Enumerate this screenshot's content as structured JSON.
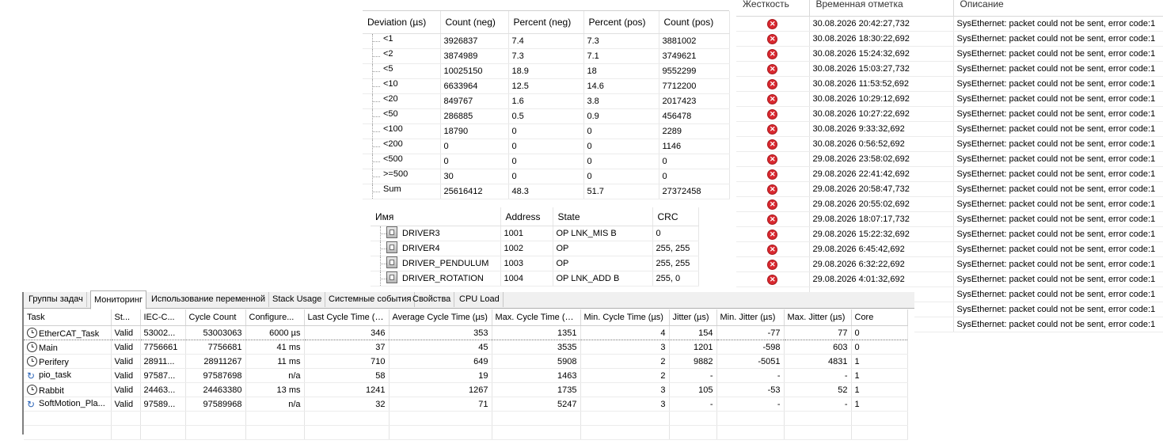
{
  "deviation_table": {
    "headers": [
      "Deviation (µs)",
      "Count (neg)",
      "Percent (neg)",
      "Percent (pos)",
      "Count (pos)"
    ],
    "rows": [
      [
        "<1",
        "3926837",
        "7.4",
        "7.3",
        "3881002"
      ],
      [
        "<2",
        "3874989",
        "7.3",
        "7.1",
        "3749621"
      ],
      [
        "<5",
        "10025150",
        "18.9",
        "18",
        "9552299"
      ],
      [
        "<10",
        "6633964",
        "12.5",
        "14.6",
        "7712200"
      ],
      [
        "<20",
        "849767",
        "1.6",
        "3.8",
        "2017423"
      ],
      [
        "<50",
        "286885",
        "0.5",
        "0.9",
        "456478"
      ],
      [
        "<100",
        "18790",
        "0",
        "0",
        "2289"
      ],
      [
        "<200",
        "0",
        "0",
        "0",
        "1146"
      ],
      [
        "<500",
        "0",
        "0",
        "0",
        "0"
      ],
      [
        ">=500",
        "30",
        "0",
        "0",
        "0"
      ],
      [
        "Sum",
        "25616412",
        "48.3",
        "51.7",
        "27372458"
      ]
    ]
  },
  "drivers_table": {
    "headers": [
      "Имя",
      "Address",
      "State",
      "CRC"
    ],
    "rows": [
      [
        "DRIVER3",
        "1001",
        "OP LNK_MIS B",
        "0"
      ],
      [
        "DRIVER4",
        "1002",
        "OP",
        "255, 255"
      ],
      [
        "DRIVER_PENDULUM",
        "1003",
        "OP",
        "255, 255"
      ],
      [
        "DRIVER_ROTATION",
        "1004",
        "OP LNK_ADD B",
        "255, 0"
      ]
    ]
  },
  "event_log": {
    "headers": [
      "Жесткость",
      "Временная отметка",
      "Описание"
    ],
    "severity_icon": "error-icon",
    "error_color": "#d9282f",
    "rows": [
      [
        "30.08.2026 20:42:27,732",
        "SysEthernet: packet could not be sent, error code:1"
      ],
      [
        "30.08.2026 18:30:22,692",
        "SysEthernet: packet could not be sent, error code:1"
      ],
      [
        "30.08.2026 15:24:32,692",
        "SysEthernet: packet could not be sent, error code:1"
      ],
      [
        "30.08.2026 15:03:27,732",
        "SysEthernet: packet could not be sent, error code:1"
      ],
      [
        "30.08.2026 11:53:52,692",
        "SysEthernet: packet could not be sent, error code:1"
      ],
      [
        "30.08.2026 10:29:12,692",
        "SysEthernet: packet could not be sent, error code:1"
      ],
      [
        "30.08.2026 10:27:22,692",
        "SysEthernet: packet could not be sent, error code:1"
      ],
      [
        "30.08.2026 9:33:32,692",
        "SysEthernet: packet could not be sent, error code:1"
      ],
      [
        "30.08.2026 0:56:52,692",
        "SysEthernet: packet could not be sent, error code:1"
      ],
      [
        "29.08.2026 23:58:02,692",
        "SysEthernet: packet could not be sent, error code:1"
      ],
      [
        "29.08.2026 22:41:42,692",
        "SysEthernet: packet could not be sent, error code:1"
      ],
      [
        "29.08.2026 20:58:47,732",
        "SysEthernet: packet could not be sent, error code:1"
      ],
      [
        "29.08.2026 20:55:02,692",
        "SysEthernet: packet could not be sent, error code:1"
      ],
      [
        "29.08.2026 18:07:17,732",
        "SysEthernet: packet could not be sent, error code:1"
      ],
      [
        "29.08.2026 15:22:32,692",
        "SysEthernet: packet could not be sent, error code:1"
      ],
      [
        "29.08.2026 6:45:42,692",
        "SysEthernet: packet could not be sent, error code:1"
      ],
      [
        "29.08.2026 6:32:22,692",
        "SysEthernet: packet could not be sent, error code:1"
      ],
      [
        "29.08.2026 4:01:32,692",
        "SysEthernet: packet could not be sent, error code:1"
      ],
      [
        "",
        "SysEthernet: packet could not be sent, error code:1"
      ],
      [
        "",
        "SysEthernet: packet could not be sent, error code:1"
      ],
      [
        "",
        "SysEthernet: packet could not be sent, error code:1"
      ]
    ]
  },
  "task_panel": {
    "tabs": [
      "Группы задач",
      "Мониторинг",
      "Использование переменной",
      "Stack Usage",
      "Системные события",
      "Свойства",
      "CPU Load"
    ],
    "active_tab": "Мониторинг",
    "headers": [
      "Task",
      "St...",
      "IEC-C...",
      "Cycle Count",
      "Configure...",
      "Last Cycle Time (µs)",
      "Average Cycle Time (µs)",
      "Max. Cycle Time (µs)",
      "Min. Cycle Time (µs)",
      "Jitter (µs)",
      "Min. Jitter (µs)",
      "Max. Jitter (µs)",
      "Core"
    ],
    "rows": [
      {
        "icon": "clock-icon",
        "cells": [
          "EtherCAT_Task",
          "Valid",
          "53002...",
          "53003063",
          "6000 µs",
          "346",
          "353",
          "1351",
          "4",
          "154",
          "-77",
          "77",
          "0"
        ]
      },
      {
        "icon": "clock-icon",
        "cells": [
          "Main",
          "Valid",
          "7756661",
          "7756681",
          "41 ms",
          "37",
          "45",
          "3535",
          "3",
          "1201",
          "-598",
          "603",
          "0"
        ]
      },
      {
        "icon": "clock-icon",
        "cells": [
          "Perifery",
          "Valid",
          "28911...",
          "28911267",
          "11 ms",
          "710",
          "649",
          "5908",
          "2",
          "9882",
          "-5051",
          "4831",
          "1"
        ]
      },
      {
        "icon": "freewheeling-icon",
        "cells": [
          "pio_task",
          "Valid",
          "97587...",
          "97587698",
          "n/a",
          "58",
          "19",
          "1463",
          "2",
          "-",
          "-",
          "-",
          "1"
        ]
      },
      {
        "icon": "clock-icon",
        "cells": [
          "Rabbit",
          "Valid",
          "24463...",
          "24463380",
          "13 ms",
          "1241",
          "1267",
          "1735",
          "3",
          "105",
          "-53",
          "52",
          "1"
        ]
      },
      {
        "icon": "freewheeling-icon",
        "cells": [
          "SoftMotion_Pla...",
          "Valid",
          "97589...",
          "97589968",
          "n/a",
          "32",
          "71",
          "5247",
          "3",
          "-",
          "-",
          "-",
          "1"
        ]
      }
    ]
  }
}
